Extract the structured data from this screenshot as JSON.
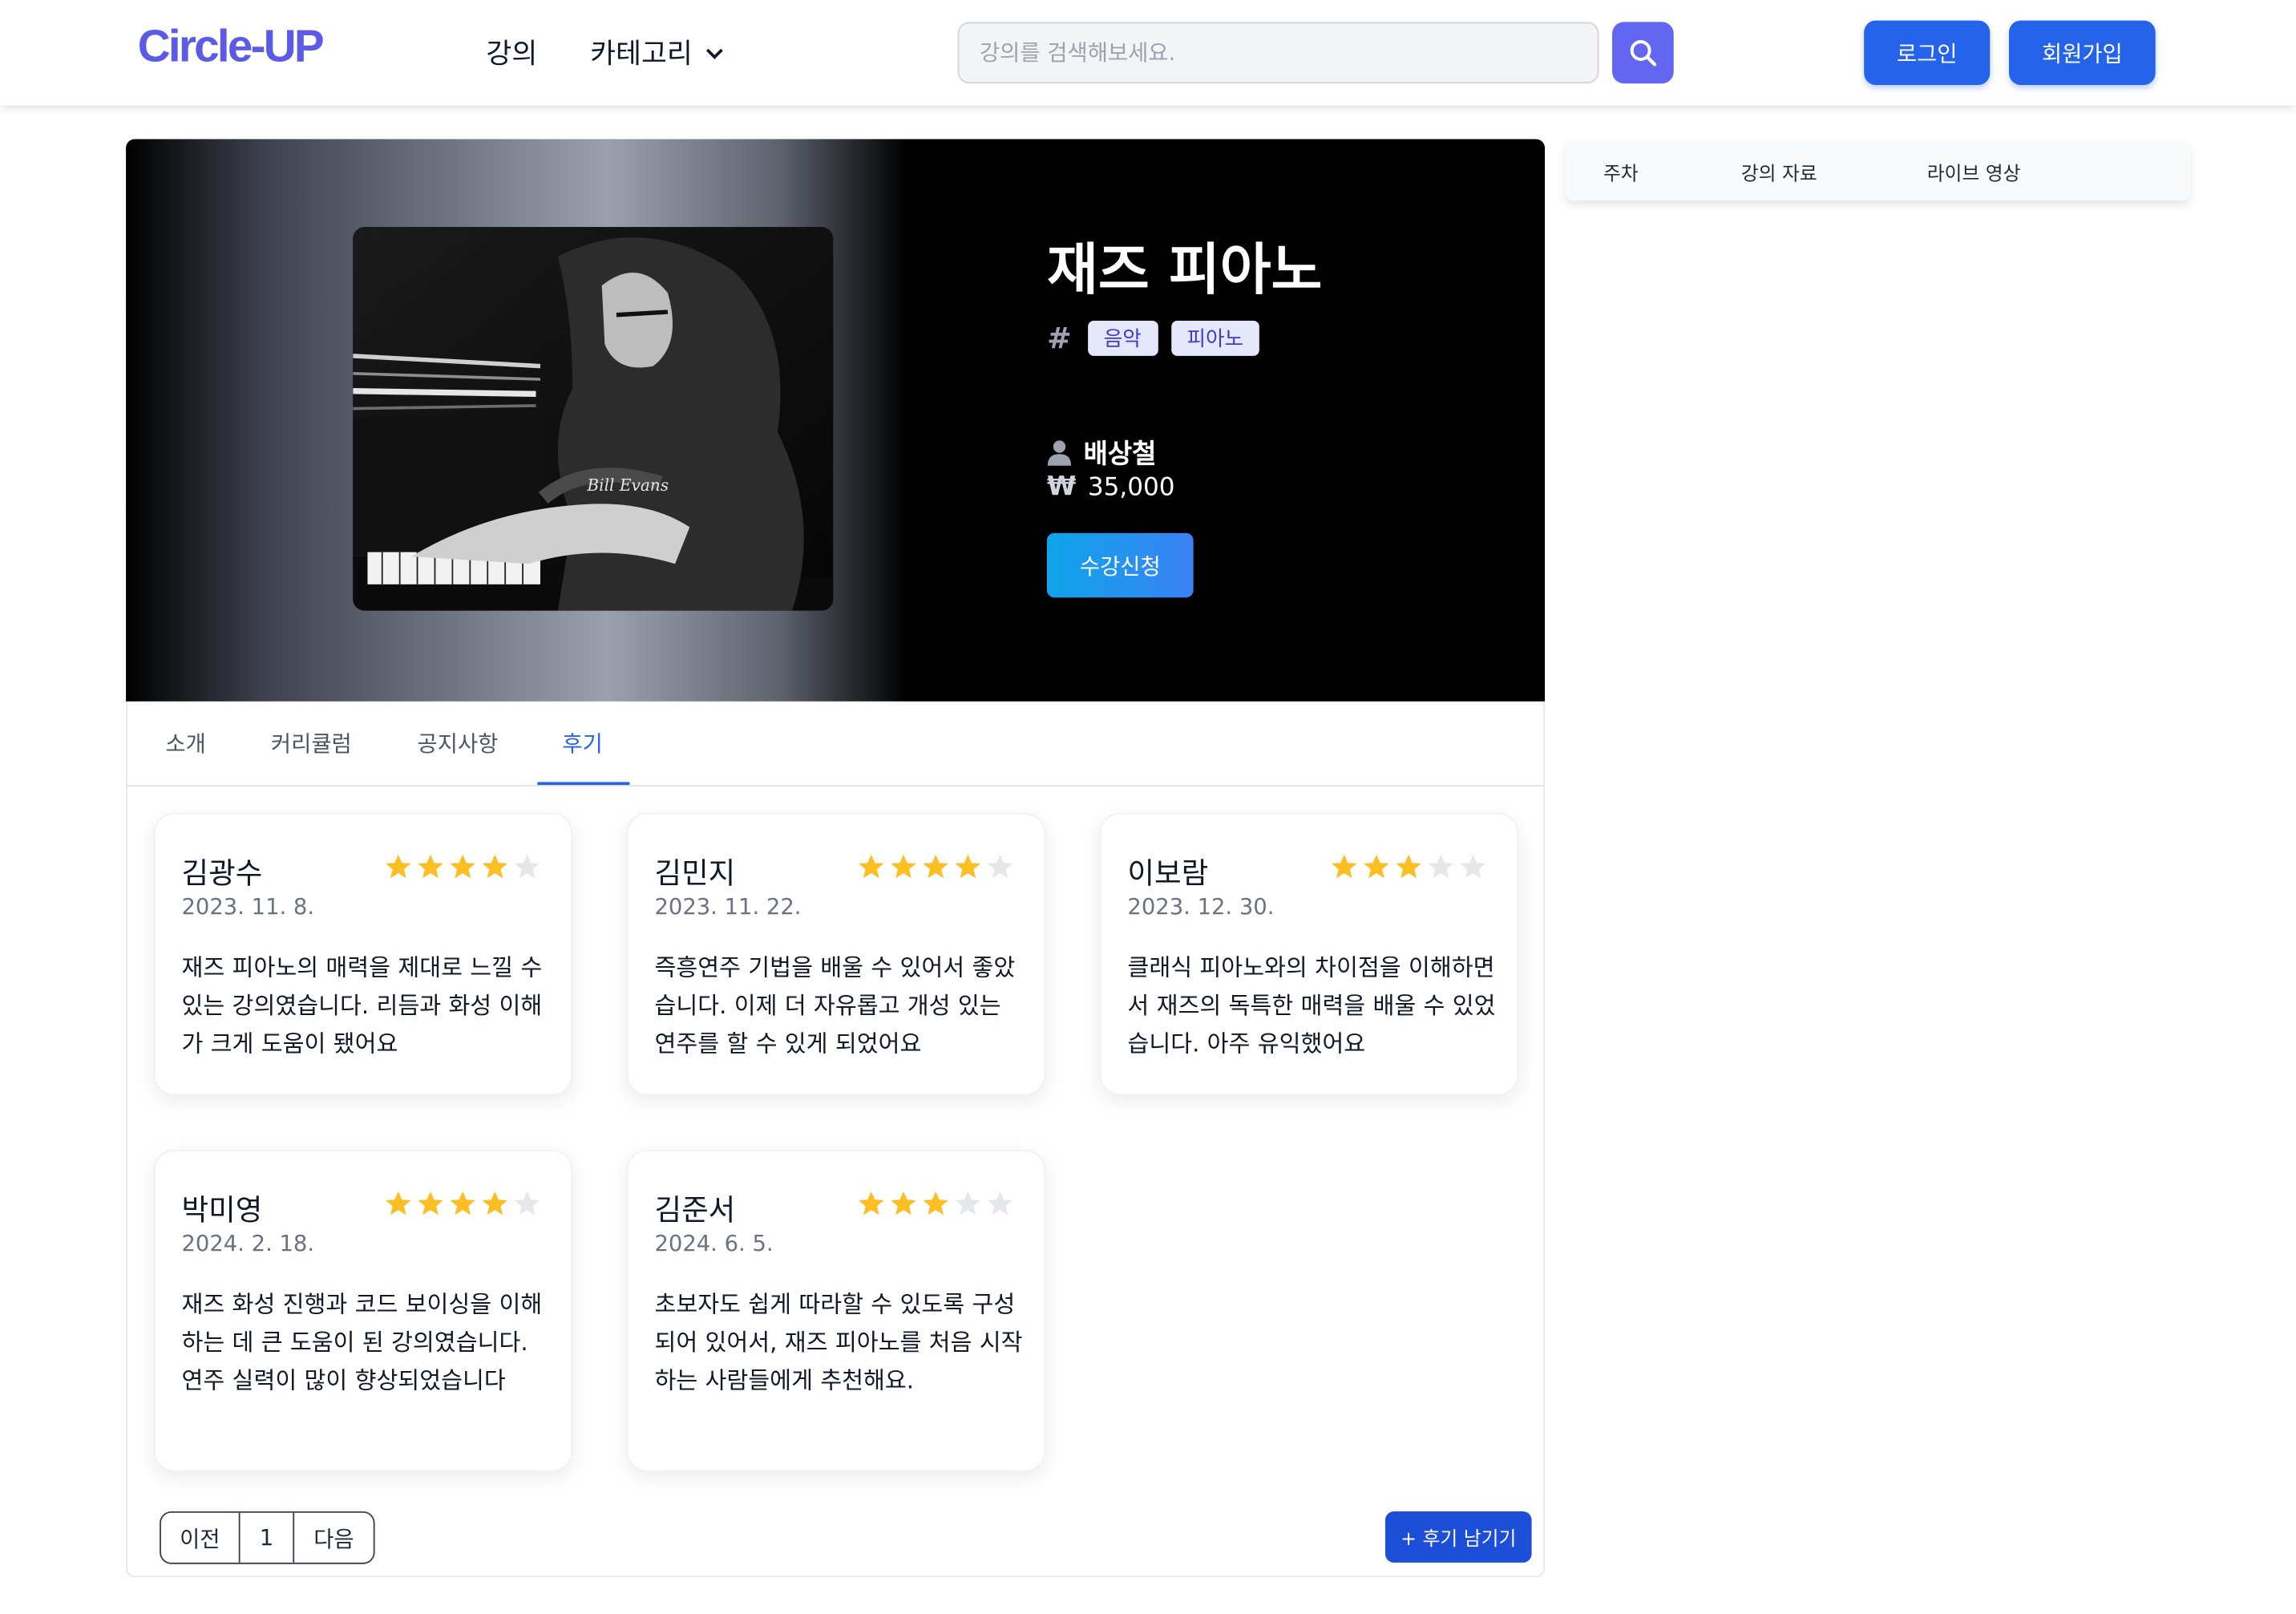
{
  "header": {
    "logo": "Circle-UP",
    "nav": {
      "lecture": "강의",
      "category": "카테고리"
    },
    "search_placeholder": "강의를 검색해보세요.",
    "login": "로그인",
    "signup": "회원가입"
  },
  "course": {
    "image_caption": "Bill Evans",
    "title": "재즈 피아노",
    "tags": [
      "음악",
      "피아노"
    ],
    "instructor": "배상철",
    "price": "35,000",
    "enroll": "수강신청"
  },
  "tabs": [
    "소개",
    "커리큘럼",
    "공지사항",
    "후기"
  ],
  "active_tab": "후기",
  "reviews": [
    {
      "name": "김광수",
      "date": "2023. 11. 8.",
      "rating": 4,
      "text": "재즈 피아노의 매력을 제대로 느낄 수 있는 강의였습니다. 리듬과 화성 이해가 크게 도움이 됐어요"
    },
    {
      "name": "김민지",
      "date": "2023. 11. 22.",
      "rating": 4,
      "text": "즉흥연주 기법을 배울 수 있어서 좋았습니다. 이제 더 자유롭고 개성 있는 연주를 할 수 있게 되었어요"
    },
    {
      "name": "이보람",
      "date": "2023. 12. 30.",
      "rating": 3,
      "text": "클래식 피아노와의 차이점을 이해하면서 재즈의 독특한 매력을 배울 수 있었습니다. 아주 유익했어요"
    },
    {
      "name": "박미영",
      "date": "2024. 2. 18.",
      "rating": 4,
      "text": "재즈 화성 진행과 코드 보이싱을 이해하는 데 큰 도움이 된 강의였습니다. 연주 실력이 많이 향상되었습니다"
    },
    {
      "name": "김준서",
      "date": "2024. 6. 5.",
      "rating": 3,
      "text": "초보자도 쉽게 따라할 수 있도록 구성되어 있어서, 재즈 피아노를 처음 시작하는 사람들에게 추천해요."
    }
  ],
  "pagination": {
    "prev": "이전",
    "page": "1",
    "next": "다음"
  },
  "write_review": "+ 후기 남기기",
  "side_tabs": [
    "주차",
    "강의 자료",
    "라이브 영상"
  ],
  "colors": {
    "primary": "#2563eb",
    "search": "#6366f1",
    "star_on": "#fbbf24",
    "star_off": "#e5e7eb",
    "tag_bg": "#e5e7fb"
  },
  "icons": {
    "search": "search-icon",
    "category": "chevron-down-icon",
    "instructor": "user-icon",
    "price": "won-icon",
    "hashtag": "hashtag-icon",
    "rating": "star-icon"
  }
}
